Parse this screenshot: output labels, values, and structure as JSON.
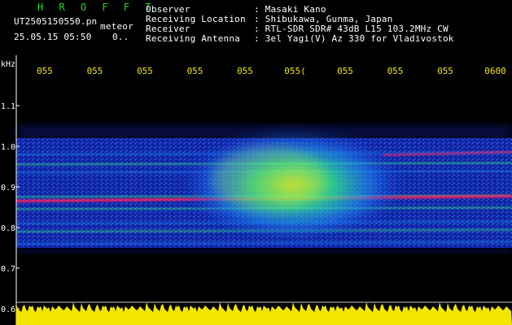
{
  "header": {
    "logo": "H R O F F T",
    "file_name": "UT2505150550.pn",
    "mode": "meteor",
    "datetime": "25.05.15 05:50",
    "status_char": "0..",
    "info_labels": [
      "Observer",
      "Receiving Location",
      "Receiver",
      "Receiving Antenna"
    ],
    "info_values": [
      ": Masaki Kano",
      ": Shibukawa, Gunma, Japan",
      ": RTL-SDR SDR# 43dB L15 103.2MHz CW",
      ": 3el Yagi(V) Az 330 for Vladivostok"
    ]
  },
  "chart_data": {
    "type": "heatmap",
    "ylabel": "kHz",
    "y_ticks": [
      "1.1",
      "1.0",
      "0.9",
      "0.8",
      "0.7",
      "0.6"
    ],
    "y_tick_values": [
      1.1,
      1.0,
      0.9,
      0.8,
      0.7,
      0.6
    ],
    "ylim": [
      0.595,
      1.16
    ],
    "x_ticks": [
      "055",
      "055",
      "055",
      "055",
      "055",
      "055(",
      "055",
      "055",
      "055",
      "0600"
    ],
    "carrier_lines_khz": [
      0.98,
      0.955,
      0.935,
      0.875,
      0.865,
      0.845,
      0.81,
      0.79,
      0.76
    ],
    "strong_carrier_khz": 0.865,
    "meteor_burst_center_khz": 0.905,
    "colors": {
      "background": "#000000",
      "noise_low": "#1a2fd0",
      "noise_mid": "#1e90ff",
      "signal_green": "#35ff80",
      "signal_yellow": "#e6f020",
      "signal_red": "#ff2060",
      "tick_yellow": "#f2e600",
      "logo_green": "#22dd22"
    },
    "grid": false
  }
}
